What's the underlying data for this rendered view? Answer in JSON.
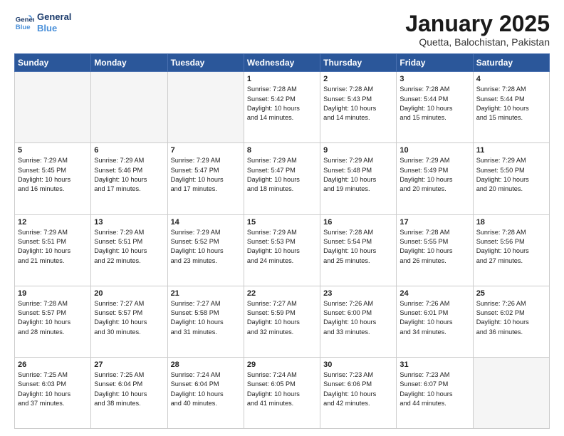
{
  "header": {
    "logo_general": "General",
    "logo_blue": "Blue",
    "month_title": "January 2025",
    "location": "Quetta, Balochistan, Pakistan"
  },
  "weekdays": [
    "Sunday",
    "Monday",
    "Tuesday",
    "Wednesday",
    "Thursday",
    "Friday",
    "Saturday"
  ],
  "weeks": [
    [
      {
        "day": "",
        "info": ""
      },
      {
        "day": "",
        "info": ""
      },
      {
        "day": "",
        "info": ""
      },
      {
        "day": "1",
        "info": "Sunrise: 7:28 AM\nSunset: 5:42 PM\nDaylight: 10 hours\nand 14 minutes."
      },
      {
        "day": "2",
        "info": "Sunrise: 7:28 AM\nSunset: 5:43 PM\nDaylight: 10 hours\nand 14 minutes."
      },
      {
        "day": "3",
        "info": "Sunrise: 7:28 AM\nSunset: 5:44 PM\nDaylight: 10 hours\nand 15 minutes."
      },
      {
        "day": "4",
        "info": "Sunrise: 7:28 AM\nSunset: 5:44 PM\nDaylight: 10 hours\nand 15 minutes."
      }
    ],
    [
      {
        "day": "5",
        "info": "Sunrise: 7:29 AM\nSunset: 5:45 PM\nDaylight: 10 hours\nand 16 minutes."
      },
      {
        "day": "6",
        "info": "Sunrise: 7:29 AM\nSunset: 5:46 PM\nDaylight: 10 hours\nand 17 minutes."
      },
      {
        "day": "7",
        "info": "Sunrise: 7:29 AM\nSunset: 5:47 PM\nDaylight: 10 hours\nand 17 minutes."
      },
      {
        "day": "8",
        "info": "Sunrise: 7:29 AM\nSunset: 5:47 PM\nDaylight: 10 hours\nand 18 minutes."
      },
      {
        "day": "9",
        "info": "Sunrise: 7:29 AM\nSunset: 5:48 PM\nDaylight: 10 hours\nand 19 minutes."
      },
      {
        "day": "10",
        "info": "Sunrise: 7:29 AM\nSunset: 5:49 PM\nDaylight: 10 hours\nand 20 minutes."
      },
      {
        "day": "11",
        "info": "Sunrise: 7:29 AM\nSunset: 5:50 PM\nDaylight: 10 hours\nand 20 minutes."
      }
    ],
    [
      {
        "day": "12",
        "info": "Sunrise: 7:29 AM\nSunset: 5:51 PM\nDaylight: 10 hours\nand 21 minutes."
      },
      {
        "day": "13",
        "info": "Sunrise: 7:29 AM\nSunset: 5:51 PM\nDaylight: 10 hours\nand 22 minutes."
      },
      {
        "day": "14",
        "info": "Sunrise: 7:29 AM\nSunset: 5:52 PM\nDaylight: 10 hours\nand 23 minutes."
      },
      {
        "day": "15",
        "info": "Sunrise: 7:29 AM\nSunset: 5:53 PM\nDaylight: 10 hours\nand 24 minutes."
      },
      {
        "day": "16",
        "info": "Sunrise: 7:28 AM\nSunset: 5:54 PM\nDaylight: 10 hours\nand 25 minutes."
      },
      {
        "day": "17",
        "info": "Sunrise: 7:28 AM\nSunset: 5:55 PM\nDaylight: 10 hours\nand 26 minutes."
      },
      {
        "day": "18",
        "info": "Sunrise: 7:28 AM\nSunset: 5:56 PM\nDaylight: 10 hours\nand 27 minutes."
      }
    ],
    [
      {
        "day": "19",
        "info": "Sunrise: 7:28 AM\nSunset: 5:57 PM\nDaylight: 10 hours\nand 28 minutes."
      },
      {
        "day": "20",
        "info": "Sunrise: 7:27 AM\nSunset: 5:57 PM\nDaylight: 10 hours\nand 30 minutes."
      },
      {
        "day": "21",
        "info": "Sunrise: 7:27 AM\nSunset: 5:58 PM\nDaylight: 10 hours\nand 31 minutes."
      },
      {
        "day": "22",
        "info": "Sunrise: 7:27 AM\nSunset: 5:59 PM\nDaylight: 10 hours\nand 32 minutes."
      },
      {
        "day": "23",
        "info": "Sunrise: 7:26 AM\nSunset: 6:00 PM\nDaylight: 10 hours\nand 33 minutes."
      },
      {
        "day": "24",
        "info": "Sunrise: 7:26 AM\nSunset: 6:01 PM\nDaylight: 10 hours\nand 34 minutes."
      },
      {
        "day": "25",
        "info": "Sunrise: 7:26 AM\nSunset: 6:02 PM\nDaylight: 10 hours\nand 36 minutes."
      }
    ],
    [
      {
        "day": "26",
        "info": "Sunrise: 7:25 AM\nSunset: 6:03 PM\nDaylight: 10 hours\nand 37 minutes."
      },
      {
        "day": "27",
        "info": "Sunrise: 7:25 AM\nSunset: 6:04 PM\nDaylight: 10 hours\nand 38 minutes."
      },
      {
        "day": "28",
        "info": "Sunrise: 7:24 AM\nSunset: 6:04 PM\nDaylight: 10 hours\nand 40 minutes."
      },
      {
        "day": "29",
        "info": "Sunrise: 7:24 AM\nSunset: 6:05 PM\nDaylight: 10 hours\nand 41 minutes."
      },
      {
        "day": "30",
        "info": "Sunrise: 7:23 AM\nSunset: 6:06 PM\nDaylight: 10 hours\nand 42 minutes."
      },
      {
        "day": "31",
        "info": "Sunrise: 7:23 AM\nSunset: 6:07 PM\nDaylight: 10 hours\nand 44 minutes."
      },
      {
        "day": "",
        "info": ""
      }
    ]
  ]
}
